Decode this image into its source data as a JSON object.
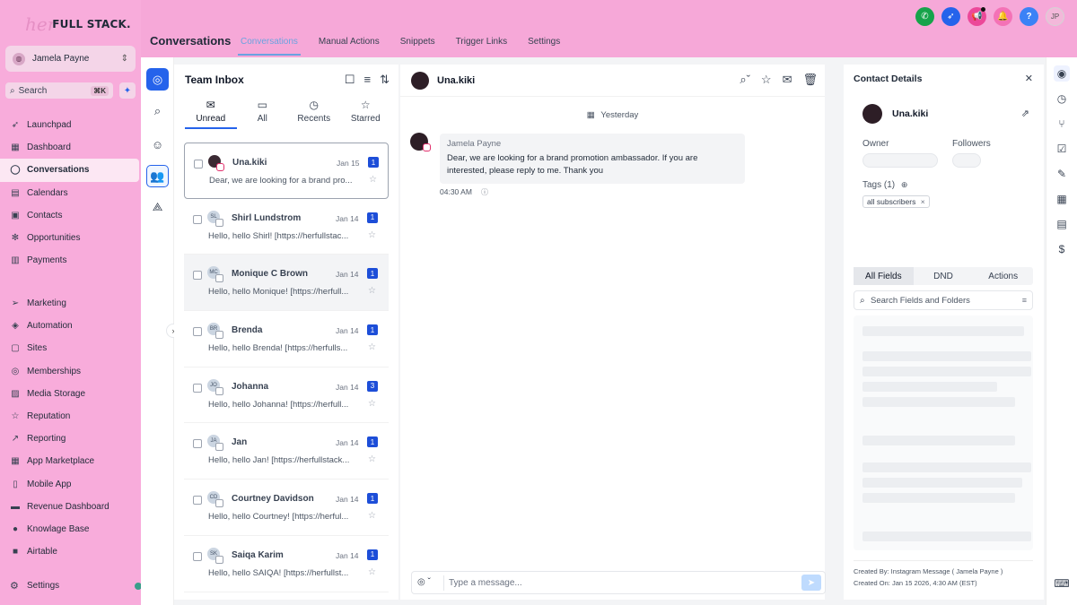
{
  "brand": {
    "logo_script": "her",
    "logo_text": "FULL STACK."
  },
  "account": {
    "name": "Jamela Payne"
  },
  "search": {
    "label": "Search",
    "shortcut": "⌘K"
  },
  "nav": {
    "group1": [
      {
        "label": "Launchpad",
        "icon": "rocket-icon"
      },
      {
        "label": "Dashboard",
        "icon": "dashboard-icon"
      },
      {
        "label": "Conversations",
        "icon": "chat-icon",
        "active": true
      },
      {
        "label": "Calendars",
        "icon": "calendar-icon"
      },
      {
        "label": "Contacts",
        "icon": "contacts-icon"
      },
      {
        "label": "Opportunities",
        "icon": "opportunities-icon"
      },
      {
        "label": "Payments",
        "icon": "payments-icon"
      }
    ],
    "group2": [
      {
        "label": "Marketing",
        "icon": "send-icon"
      },
      {
        "label": "Automation",
        "icon": "automation-icon"
      },
      {
        "label": "Sites",
        "icon": "sites-icon"
      },
      {
        "label": "Memberships",
        "icon": "membership-icon"
      },
      {
        "label": "Media Storage",
        "icon": "media-icon"
      },
      {
        "label": "Reputation",
        "icon": "star-icon"
      },
      {
        "label": "Reporting",
        "icon": "chart-icon"
      },
      {
        "label": "App Marketplace",
        "icon": "apps-icon"
      },
      {
        "label": "Mobile App",
        "icon": "mobile-icon"
      },
      {
        "label": "Revenue Dashboard",
        "icon": "revenue-icon"
      },
      {
        "label": "Knowlage Base",
        "icon": "knowledge-icon"
      },
      {
        "label": "Airtable",
        "icon": "airtable-icon"
      }
    ],
    "settings": "Settings"
  },
  "header": {
    "title": "Conversations",
    "tabs": [
      "Conversations",
      "Manual Actions",
      "Snippets",
      "Trigger Links",
      "Settings"
    ],
    "avatar_initials": "JP"
  },
  "inbox": {
    "title": "Team Inbox",
    "filters": [
      "Unread",
      "All",
      "Recents",
      "Starred"
    ],
    "conversations": [
      {
        "name": "Una.kiki",
        "date": "Jan 15",
        "count": "1",
        "preview": "Dear, we are looking for a brand pro...",
        "initials": "",
        "channel": "instagram"
      },
      {
        "name": "Shirl Lundstrom",
        "date": "Jan 14",
        "count": "1",
        "preview": "Hello, hello Shirl! [https://herfullstac...",
        "initials": "SL",
        "channel": "email"
      },
      {
        "name": "Monique C Brown",
        "date": "Jan 14",
        "count": "1",
        "preview": "Hello, hello Monique! [https://herfull...",
        "initials": "MC",
        "channel": "email"
      },
      {
        "name": "Brenda",
        "date": "Jan 14",
        "count": "1",
        "preview": "Hello, hello Brenda! [https://herfulls...",
        "initials": "BR",
        "channel": "email"
      },
      {
        "name": "Johanna",
        "date": "Jan 14",
        "count": "3",
        "preview": "Hello, hello Johanna! [https://herfull...",
        "initials": "JO",
        "channel": "email"
      },
      {
        "name": "Jan",
        "date": "Jan 14",
        "count": "1",
        "preview": "Hello, hello Jan! [https://herfullstack...",
        "initials": "JA",
        "channel": "email"
      },
      {
        "name": "Courtney Davidson",
        "date": "Jan 14",
        "count": "1",
        "preview": "Hello, hello Courtney! [https://herful...",
        "initials": "CD",
        "channel": "email"
      },
      {
        "name": "Saiqa Karim",
        "date": "Jan 14",
        "count": "1",
        "preview": "Hello, hello SAIQA! [https://herfullst...",
        "initials": "SK",
        "channel": "email"
      }
    ]
  },
  "chat": {
    "contact_name": "Una.kiki",
    "day_label": "Yesterday",
    "message": {
      "sender": "Jamela Payne",
      "text": "Dear, we are looking for a brand promotion ambassador. If you are interested, please reply to me. Thank you",
      "time": "04:30 AM"
    },
    "composer_placeholder": "Type a message..."
  },
  "contact": {
    "title": "Contact Details",
    "name": "Una.kiki",
    "owner_label": "Owner",
    "followers_label": "Followers",
    "tags_label": "Tags (1)",
    "tag": "all subscribers",
    "tabs": [
      "All Fields",
      "DND",
      "Actions"
    ],
    "search_placeholder": "Search Fields and Folders",
    "created_by": "Created By: Instagram Message ( Jamela Payne )",
    "created_on": "Created On: Jan 15 2026, 4:30 AM (EST)"
  },
  "colors": {
    "sidebar": "#f8acdb",
    "accent": "#2563eb",
    "badge": "#1d4ed8"
  }
}
